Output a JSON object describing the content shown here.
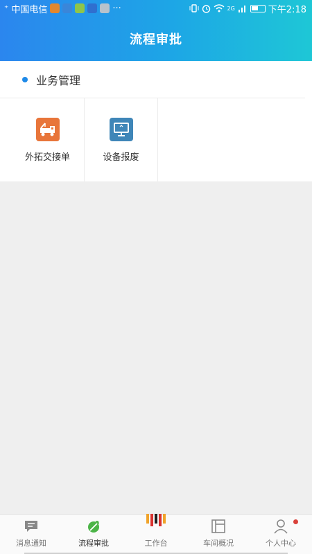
{
  "status_bar": {
    "carrier": "中国电信",
    "time": "下午2:18",
    "network_label": "2G",
    "more_label": "···"
  },
  "header": {
    "title": "流程审批"
  },
  "section": {
    "title": "业务管理",
    "items": [
      {
        "label": "外拓交接单",
        "icon": "tow-truck-icon",
        "color": "#e8753a"
      },
      {
        "label": "设备报废",
        "icon": "monitor-icon",
        "color": "#3f86b8"
      }
    ]
  },
  "tabs": [
    {
      "label": "消息通知",
      "icon": "message-icon",
      "active": false
    },
    {
      "label": "流程审批",
      "icon": "approval-leaf-icon",
      "active": true
    },
    {
      "label": "工作台",
      "icon": "workbench-logo-icon",
      "active": false
    },
    {
      "label": "车间概况",
      "icon": "workshop-layout-icon",
      "active": false
    },
    {
      "label": "个人中心",
      "icon": "person-icon",
      "active": false,
      "badge": true
    }
  ],
  "colors": {
    "header_start": "#2b86ee",
    "header_end": "#1ec7d6",
    "accent_dot": "#1f8ae8",
    "active_tab_icon": "#4cb447",
    "badge": "#d9413a"
  }
}
